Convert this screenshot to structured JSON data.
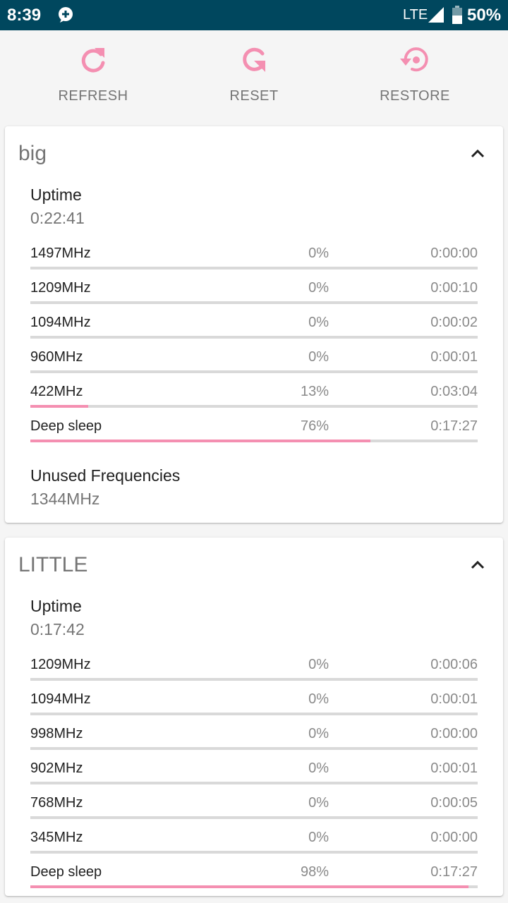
{
  "status_bar": {
    "time": "8:39",
    "network": "LTE",
    "battery": "50%"
  },
  "toolbar": {
    "accent": "#f48fb1",
    "refresh_label": "REFRESH",
    "reset_label": "RESET",
    "restore_label": "RESTORE"
  },
  "clusters": [
    {
      "title": "big",
      "uptime_label": "Uptime",
      "uptime": "0:22:41",
      "rows": [
        {
          "freq": "1497MHz",
          "percent": "0%",
          "time": "0:00:00",
          "fraction": 0.0
        },
        {
          "freq": "1209MHz",
          "percent": "0%",
          "time": "0:00:10",
          "fraction": 0.0
        },
        {
          "freq": "1094MHz",
          "percent": "0%",
          "time": "0:00:02",
          "fraction": 0.0
        },
        {
          "freq": "960MHz",
          "percent": "0%",
          "time": "0:00:01",
          "fraction": 0.0
        },
        {
          "freq": "422MHz",
          "percent": "13%",
          "time": "0:03:04",
          "fraction": 0.13
        },
        {
          "freq": "Deep sleep",
          "percent": "76%",
          "time": "0:17:27",
          "fraction": 0.76
        }
      ],
      "unused_label": "Unused Frequencies",
      "unused_value": "1344MHz"
    },
    {
      "title": "LITTLE",
      "uptime_label": "Uptime",
      "uptime": "0:17:42",
      "rows": [
        {
          "freq": "1209MHz",
          "percent": "0%",
          "time": "0:00:06",
          "fraction": 0.0
        },
        {
          "freq": "1094MHz",
          "percent": "0%",
          "time": "0:00:01",
          "fraction": 0.0
        },
        {
          "freq": "998MHz",
          "percent": "0%",
          "time": "0:00:00",
          "fraction": 0.0
        },
        {
          "freq": "902MHz",
          "percent": "0%",
          "time": "0:00:01",
          "fraction": 0.0
        },
        {
          "freq": "768MHz",
          "percent": "0%",
          "time": "0:00:05",
          "fraction": 0.0
        },
        {
          "freq": "345MHz",
          "percent": "0%",
          "time": "0:00:00",
          "fraction": 0.0
        },
        {
          "freq": "Deep sleep",
          "percent": "98%",
          "time": "0:17:27",
          "fraction": 0.98
        }
      ]
    }
  ]
}
